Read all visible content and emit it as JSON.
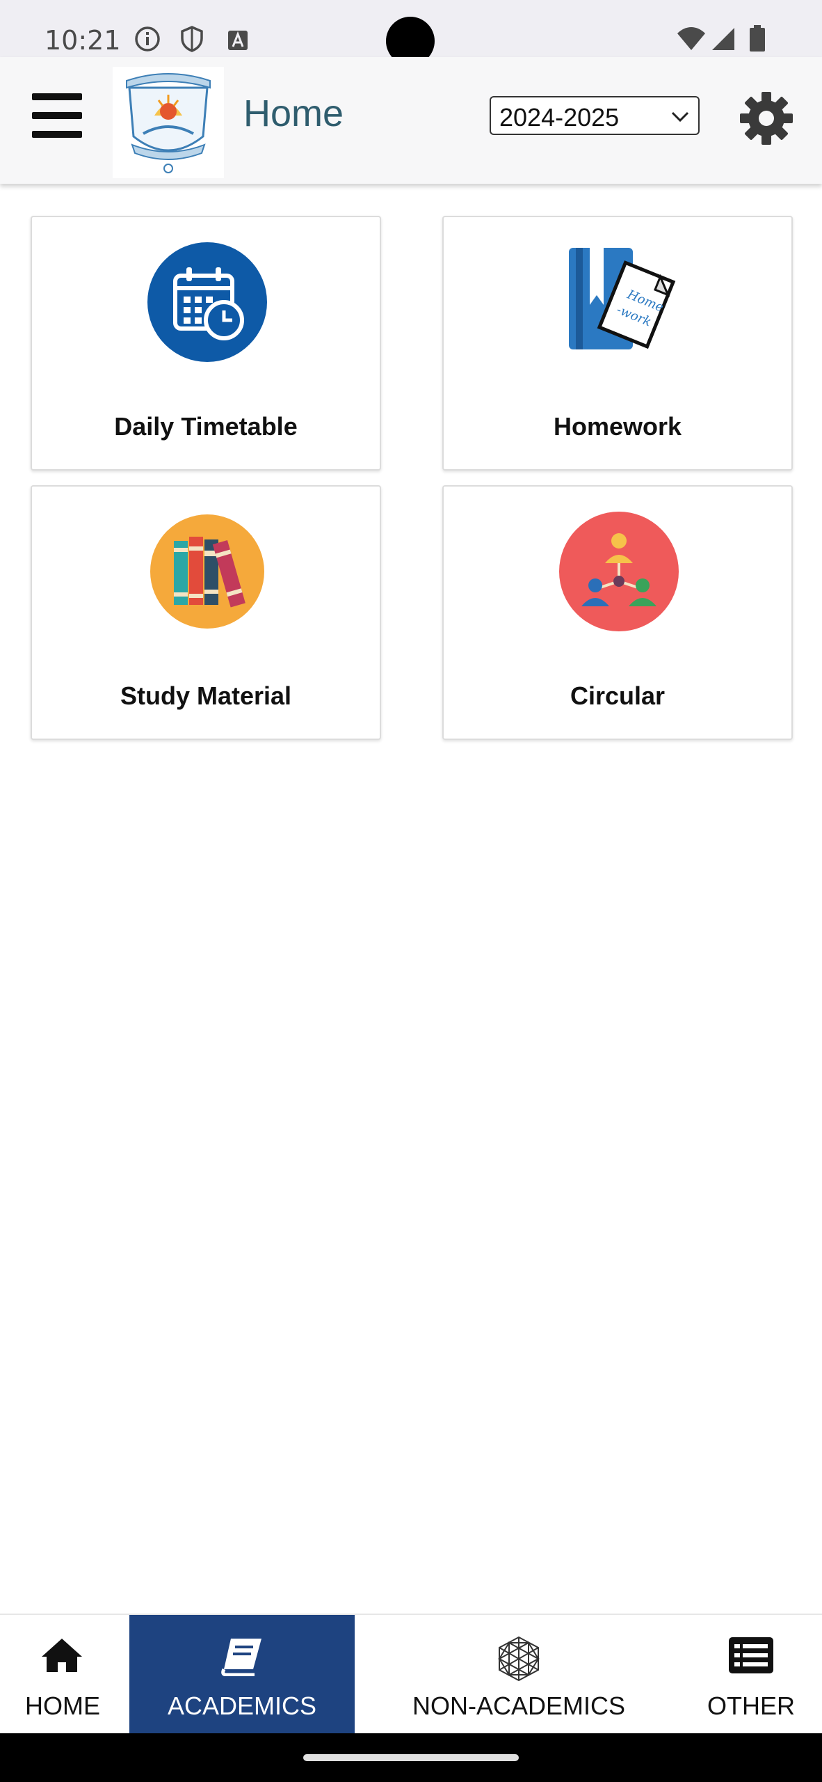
{
  "status_bar": {
    "time": "10:21"
  },
  "header": {
    "menu_icon": "hamburger-menu-icon",
    "logo_alt": "JAIPURIA",
    "title": "Home",
    "year_select": {
      "value": "2024-2025"
    },
    "settings_icon": "gear-icon"
  },
  "tiles": [
    {
      "label": "Daily Timetable",
      "icon": "calendar-clock-icon",
      "color": "#0e5aa7"
    },
    {
      "label": "Homework",
      "icon": "homework-book-icon",
      "color": "#2b79c2"
    },
    {
      "label": "Study Material",
      "icon": "books-icon",
      "color": "#f5a93b"
    },
    {
      "label": "Circular",
      "icon": "people-network-icon",
      "color": "#ef5a5a"
    }
  ],
  "bottom_nav": {
    "items": [
      {
        "label": "HOME",
        "icon": "house-icon",
        "active": false
      },
      {
        "label": "ACADEMICS",
        "icon": "book-icon",
        "active": true
      },
      {
        "label": "NON-ACADEMICS",
        "icon": "geodesic-sphere-icon",
        "active": false
      },
      {
        "label": "OTHER",
        "icon": "list-icon",
        "active": false
      }
    ],
    "active_color": "#1e4380"
  }
}
